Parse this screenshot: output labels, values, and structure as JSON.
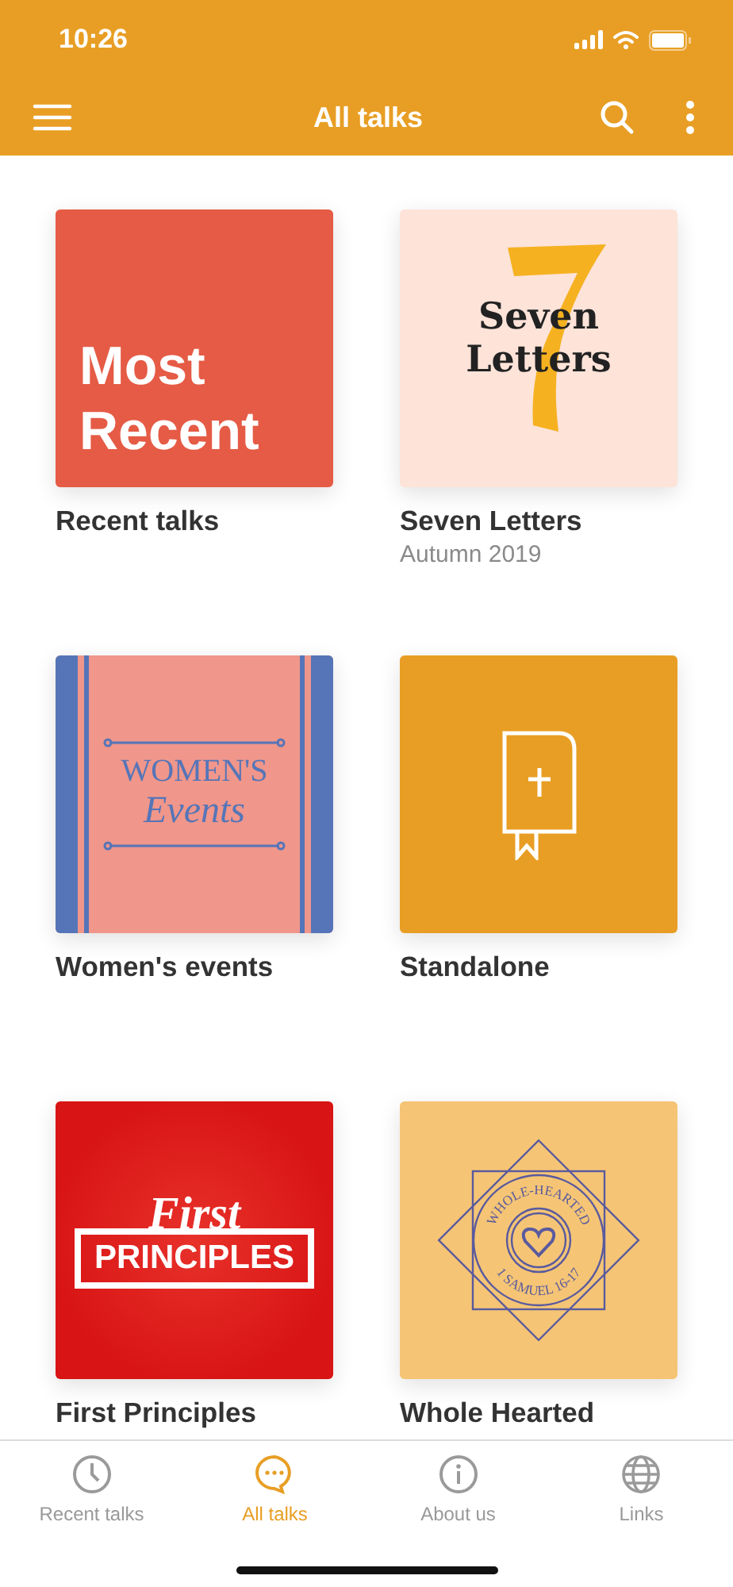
{
  "status_bar": {
    "time": "10:26"
  },
  "header": {
    "title": "All talks"
  },
  "series": [
    {
      "title": "Recent talks",
      "cover": {
        "kind": "most-recent",
        "lines": [
          "Most",
          "Recent"
        ]
      }
    },
    {
      "title": "Seven Letters",
      "subtitle": "Autumn 2019",
      "cover": {
        "kind": "seven",
        "lines": [
          "Seven",
          "Letters"
        ]
      }
    },
    {
      "title": "Women's events",
      "cover": {
        "kind": "women",
        "lines": [
          "WOMEN'S",
          "Events"
        ]
      }
    },
    {
      "title": "Standalone",
      "cover": {
        "kind": "bible"
      }
    },
    {
      "title": "First Principles",
      "cover": {
        "kind": "first",
        "lines": [
          "First",
          "PRINCIPLES"
        ]
      }
    },
    {
      "title": "Whole Hearted",
      "cover": {
        "kind": "whole",
        "lines": [
          "WHOLE-HEARTED",
          "1 SAMUEL 16-17"
        ]
      }
    }
  ],
  "tab_bar": [
    {
      "label": "Recent talks",
      "kind": "clock",
      "selected": false
    },
    {
      "label": "All talks",
      "kind": "chat",
      "selected": true
    },
    {
      "label": "About us",
      "kind": "info",
      "selected": false
    },
    {
      "label": "Links",
      "kind": "globe",
      "selected": false
    }
  ]
}
